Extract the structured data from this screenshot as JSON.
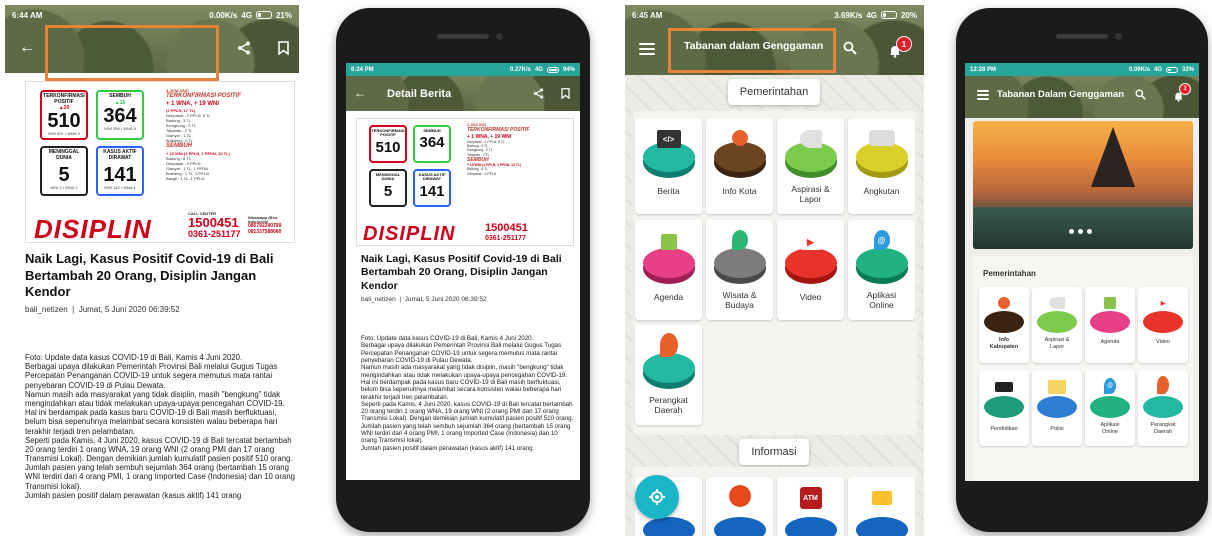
{
  "screens": {
    "s1": {
      "status": {
        "time": "6:44 AM",
        "speed": "0.00K/s",
        "network": "4G",
        "battery": "21%"
      },
      "poster": {
        "box1": {
          "title": "TERKONFIRMASI POSITIF",
          "delta": "▲20",
          "value": "510",
          "footer": "WNI 501 • WNA 9"
        },
        "box2": {
          "title": "SEMBUH",
          "delta": "▲15",
          "value": "364",
          "footer": "WNI 356 • WNA 8"
        },
        "box3": {
          "title": "MENINGGAL DUNIA",
          "value": "5",
          "footer": "WNI 3 • WNA 2"
        },
        "box4": {
          "title": "KASUS AKTIF DIRAWAT",
          "value": "141",
          "footer": "WNI 140 • WNA 1"
        },
        "date": "4 JUNI 2020",
        "r_head": "TERKONFIRMASI POSITIF",
        "r_new": "+ 1 WNA, + 19 WNI",
        "r_sub": "(2 PPLN, 17 TL)",
        "r_list": [
          "Denpasar : 2 PPLN, 8 TL",
          "Badung : 3 TL",
          "Klungkung : 2 TL",
          "Tabanan : 2 TL",
          "Gianyar : 1 TL",
          "Buleleng : 1 TL"
        ],
        "r_head2": "SEMBUH",
        "r_new2": "+ 15 WNI (4 PPLN, 1 PPDN, 10 TL)",
        "r_list2": [
          "Badung : 8 TL",
          "Denpasar : 3 PPLN",
          "Gianyar : 1 TL, 1 PPDN",
          "Buleleng : 1 TL, 1 PPLN",
          "Bangli : 1 TL, 1 PPLN"
        ],
        "disiplin": "DISIPLIN",
        "call": "CALL CENTER",
        "phone1": "1500451",
        "phone2": "0361-251177",
        "wa": "Whatsapp (Bhs. Indonesia)",
        "wa1": "085792240799",
        "wa2": "081337588060"
      },
      "title": "Naik Lagi, Kasus Positif Covid-19 di Bali Bertambah 20 Orang, Disiplin Jangan Kendor",
      "author": "bali_netizen",
      "date": "Jumat, 5 Juni 2020 06:39:52",
      "body": "Foto: Update data kasus COVID-19 di Bali, Kamis 4 Juni 2020.\nBerbagai upaya dilakukan Pemerintah Provinsi Bali melalui Gugus Tugas Percepatan Penanganan COVID-19 untuk segera memutus mata rantai penyebaran COVID-19 di Pulau Dewata.\nNamun masih ada masyarakat yang tidak disiplin, masih \"bengkung\" tidak mengindahkan atau tidak melakukan upaya-upaya pencegahan COVID-19.\nHal ini berdampak pada kasus baru COVID-19 di Bali masih berfluktuasi, belum bisa sepenuhnya melambat secara konsisten walau beberapa hari terakhir terjadi tren pelambatan.\nSeperti pada Kamis, 4 Juni 2020, kasus COVID-19 di Bali tercatat bertambah 20 orang terdiri 1 orang WNA, 19 orang WNI (2 orang PMI dan 17 orang Transmisi Lokal). Dengan demikian jumlah kumulatif pasien positif 510 orang.\nJumlah pasien yang telah sembuh sejumlah 364 orang (bertambah 15 orang WNI terdiri dari 4 orang PMI, 1 orang Imported Case (Indonesia) dan 10 orang Transmisi lokal).\nJumlah pasien positif dalam perawatan (kasus aktif) 141 orang"
    },
    "s2": {
      "status": {
        "time": "6:24 PM",
        "speed": "0.27K/s",
        "network": "4G",
        "battery": "94%"
      },
      "header": "Detail Berita",
      "title": "Naik Lagi, Kasus Positif Covid-19 di Bali Bertambah 20 Orang, Disiplin Jangan Kendor",
      "author": "bali_netizen",
      "date": "Jumat, 5 Juni 2020 06:39:52",
      "body": "Foto: Update data kasus COVID-19 di Bali, Kamis 4 Juni 2020.\nBerbagai upaya dilakukan Pemerintah Provinsi Bali melalui Gugus Tugas Percepatan Penanganan COVID-19 untuk segera memutus mata rantai penyebaran COVID-19 di Pulau Dewata.\nNamun masih ada masyarakat yang tidak disiplin, masih \"bengkung\" tidak mengindahkan atau tidak melakukan upaya-upaya pencegahan COVID-19.\nHal ini berdampak pada kasus baru COVID-19 di Bali masih berfluktuasi, belum bisa sepenuhnya melambat secara konsisten walau beberapa hari terakhir terjadi tren pelambatan.\nSeperti pada Kamis, 4 Juni 2020, kasus COVID-19 di Bali tercatat bertambah 20 orang terdiri 1 orang WNA, 19 orang WNI (2 orang PMI dan 17 orang Transmisi Lokal). Dengan demikian jumlah kumulatif pasien positif 510 orang.\nJumlah pasien yang telah sembuh sejumlah 364 orang (bertambah 15 orang WNI terdiri dari 4 orang PMI, 1 orang Imported Case (Indonesia) dan 10 orang Transmisi lokal).\nJumlah pasien positif dalam perawatan (kasus aktif) 141 orang"
    },
    "s3": {
      "status": {
        "time": "6:45 AM",
        "speed": "3.69K/s",
        "network": "4G",
        "battery": "20%"
      },
      "app_title": "Tabanan dalam Genggaman",
      "notif": "1",
      "section1": "Pemerintahan",
      "section2": "Informasi",
      "tiles": [
        "Berita",
        "Info Kota",
        "Aspirasi & Lapor",
        "Angkutan",
        "Agenda",
        "Wisata & Budaya",
        "Video",
        "Aplikasi Online",
        "Perangkat Daerah"
      ]
    },
    "s4": {
      "status": {
        "time": "12:28 PM",
        "speed": "0.09K/s",
        "network": "4G",
        "battery": "32%"
      },
      "app_title": "Tabanan Dalam Genggaman",
      "notif": "1",
      "section": "Pemerintahan",
      "tiles": [
        "Info Kabupaten",
        "Aspirasi & Lapor",
        "Agenda",
        "Video",
        "Pendidikan",
        "Polisi",
        "Aplikasi Online",
        "Perangkat Daerah"
      ]
    }
  },
  "colors": {
    "status_teal": "#26a69a",
    "highlight": "#e8833a",
    "accent_red": "#d0021b"
  }
}
